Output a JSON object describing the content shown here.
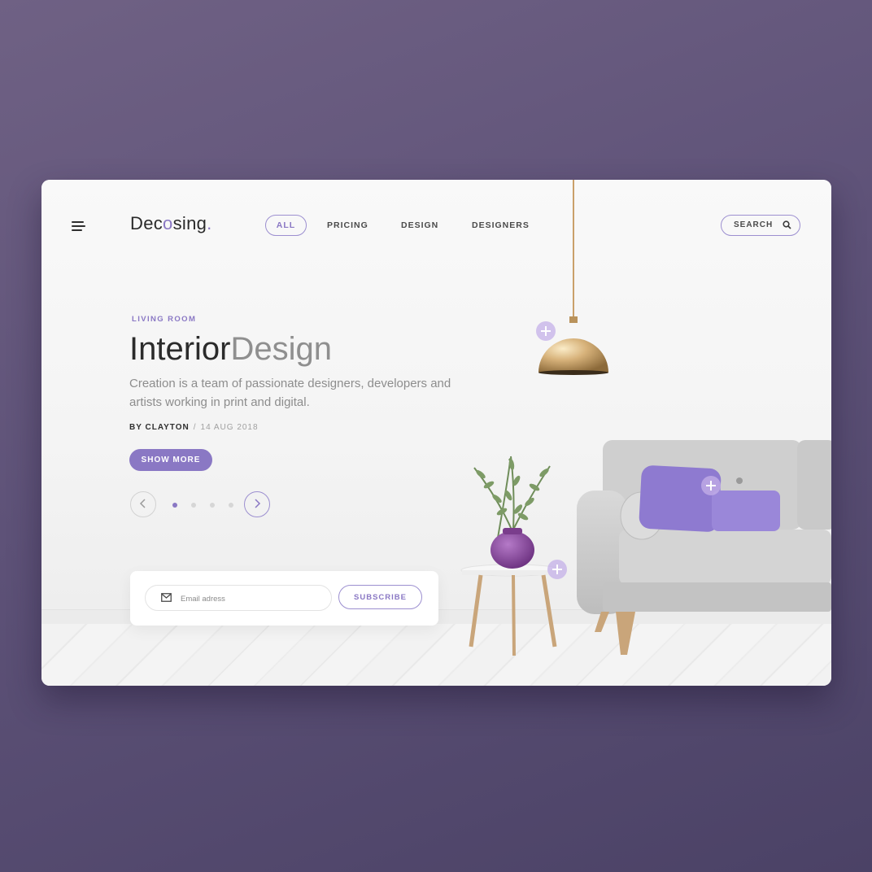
{
  "brand": {
    "logo_prefix": "Dec",
    "logo_o": "o",
    "logo_suffix": "sing",
    "logo_dot": "."
  },
  "nav": {
    "items": [
      "ALL",
      "PRICING",
      "DESIGN",
      "DESIGNERS"
    ],
    "active": "ALL"
  },
  "search": {
    "label": "SEARCH"
  },
  "hero": {
    "eyebrow": "LIVING ROOM",
    "title_main": "Interior",
    "title_light": "Design",
    "description": "Creation is a team of passionate designers, developers and artists working in print and digital.",
    "author": "BY CLAYTON",
    "separator": "/",
    "date": "14 AUG 2018",
    "cta": "SHOW MORE"
  },
  "carousel": {
    "slides": 4,
    "active_index": 0
  },
  "subscribe": {
    "email_placeholder": "Email adress",
    "button": "SUBSCRIBE"
  },
  "colors": {
    "accent": "#8a78c4",
    "accent_border": "#9c8fd0",
    "background": "#5e5278",
    "text": "#2b2b2b"
  },
  "icons": [
    "menu-icon",
    "search-icon",
    "chevron-left-icon",
    "chevron-right-icon",
    "mail-icon",
    "plus-icon"
  ]
}
